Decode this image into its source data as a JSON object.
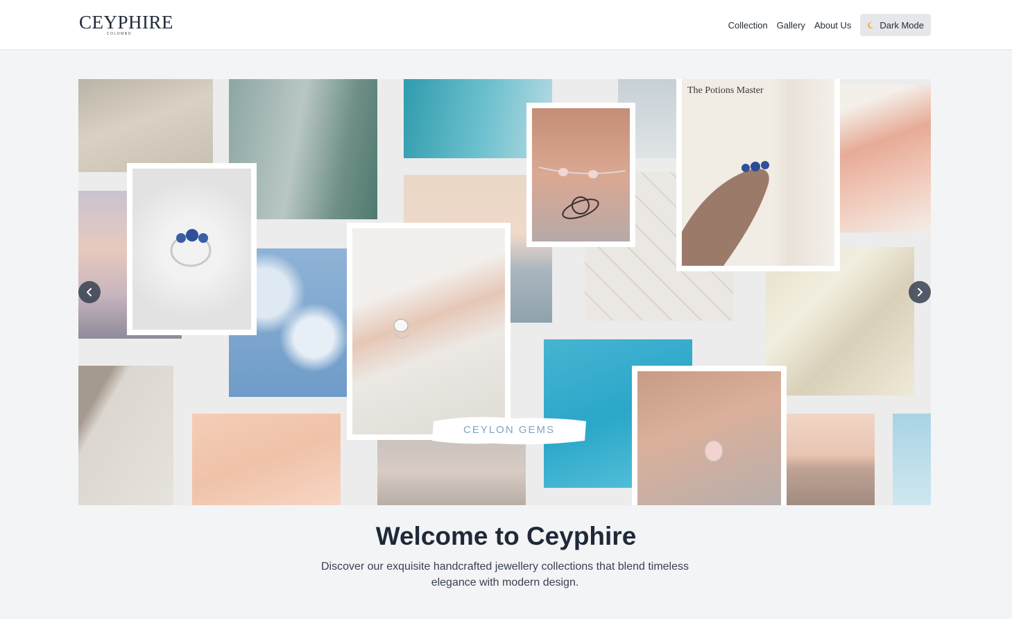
{
  "header": {
    "logo_text": "CEYPHIRE",
    "logo_sub": "COLOMBO",
    "nav": [
      {
        "label": "Collection"
      },
      {
        "label": "Gallery"
      },
      {
        "label": "About Us"
      }
    ],
    "dark_mode_label": "Dark Mode",
    "dark_mode_icon": "moon-icon"
  },
  "carousel": {
    "overlay_text": "CEYLON GEMS",
    "prev_icon": "chevron-left-icon",
    "next_icon": "chevron-right-icon"
  },
  "welcome": {
    "title": "Welcome to Ceyphire",
    "subtitle": "Discover our exquisite handcrafted jewellery collections that blend timeless elegance with modern design."
  },
  "colors": {
    "background": "#f3f4f6",
    "header_bg": "#ffffff",
    "button_bg": "#e5e7eb",
    "text": "#1f2937",
    "arrow_bg": "#374151"
  }
}
